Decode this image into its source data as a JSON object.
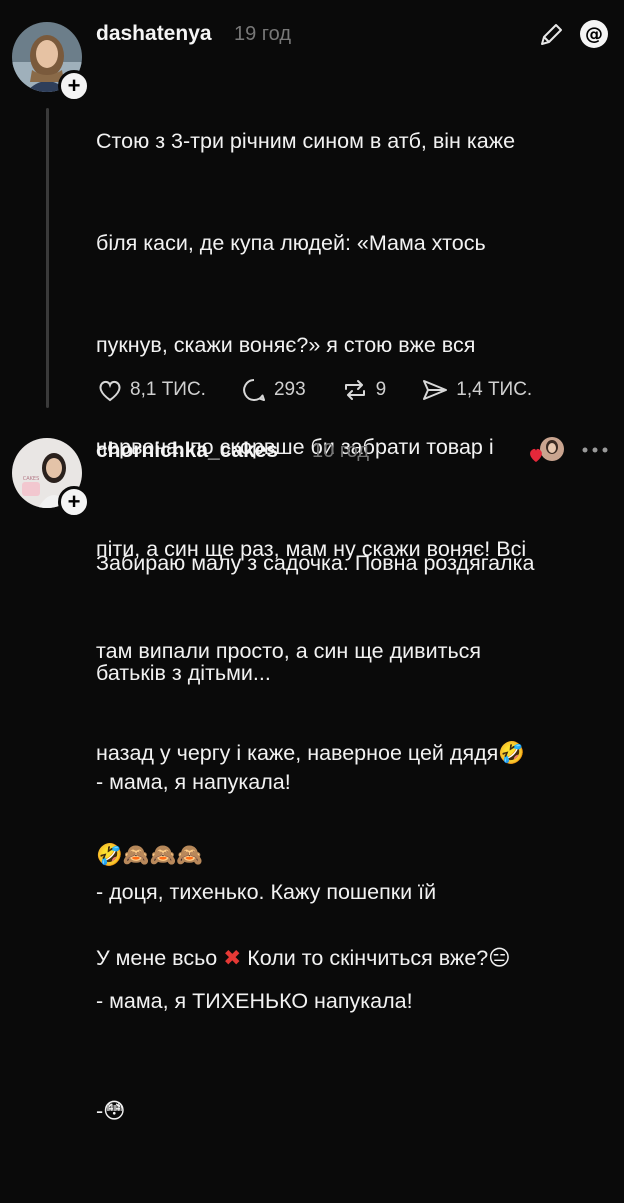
{
  "posts": [
    {
      "username": "dashatenya",
      "time": "19 год",
      "text": "Стою з 3-три річним сином в атб, він каже біля каси, де купа людей: «Мама хтось пукнув, скажи воняє?» я стою вже вся червона, по скорвше би забрати товар і піти, а син ще раз, мам ну скажи воняє! Всі там випали просто, а син ще дивиться назад у чергу і каже, наверное цей дядя",
      "line1": "Стою з 3-три річним сином в атб, він каже",
      "line2": "біля каси, де купа людей: «Мама хтось",
      "line3": "пукнув, скажи воняє?» я стою вже вся",
      "line4": "червона, по скорвше би забрати товар і",
      "line5": "піти, а син ще раз, мам ну скажи воняє! Всі",
      "line6": "там випали просто, а син ще дивиться",
      "line7": "назад у чергу і каже, наверное цей дядя",
      "line9a": "У мене всьо",
      "line9b": "Коли то скінчиться вже?",
      "likes": "8,1 ТИС.",
      "comments": "293",
      "reposts": "9",
      "shares": "1,4 ТИС."
    },
    {
      "username": "chornichka_cakes",
      "time": "10 год",
      "line1": "Забираю малу з садочка. Повна роздягалка",
      "line2": "батьків з дітьми...",
      "line3": "- мама, я напукала!",
      "line4": "- доця, тихенько. Кажу пошепки їй",
      "line5": "- мама, я ТИХЕНЬКО напукала!",
      "line6": "-"
    }
  ],
  "icons": [
    "edit-icon",
    "threads-logo-icon",
    "heart-icon",
    "comment-icon",
    "repost-icon",
    "share-icon",
    "more-icon"
  ]
}
